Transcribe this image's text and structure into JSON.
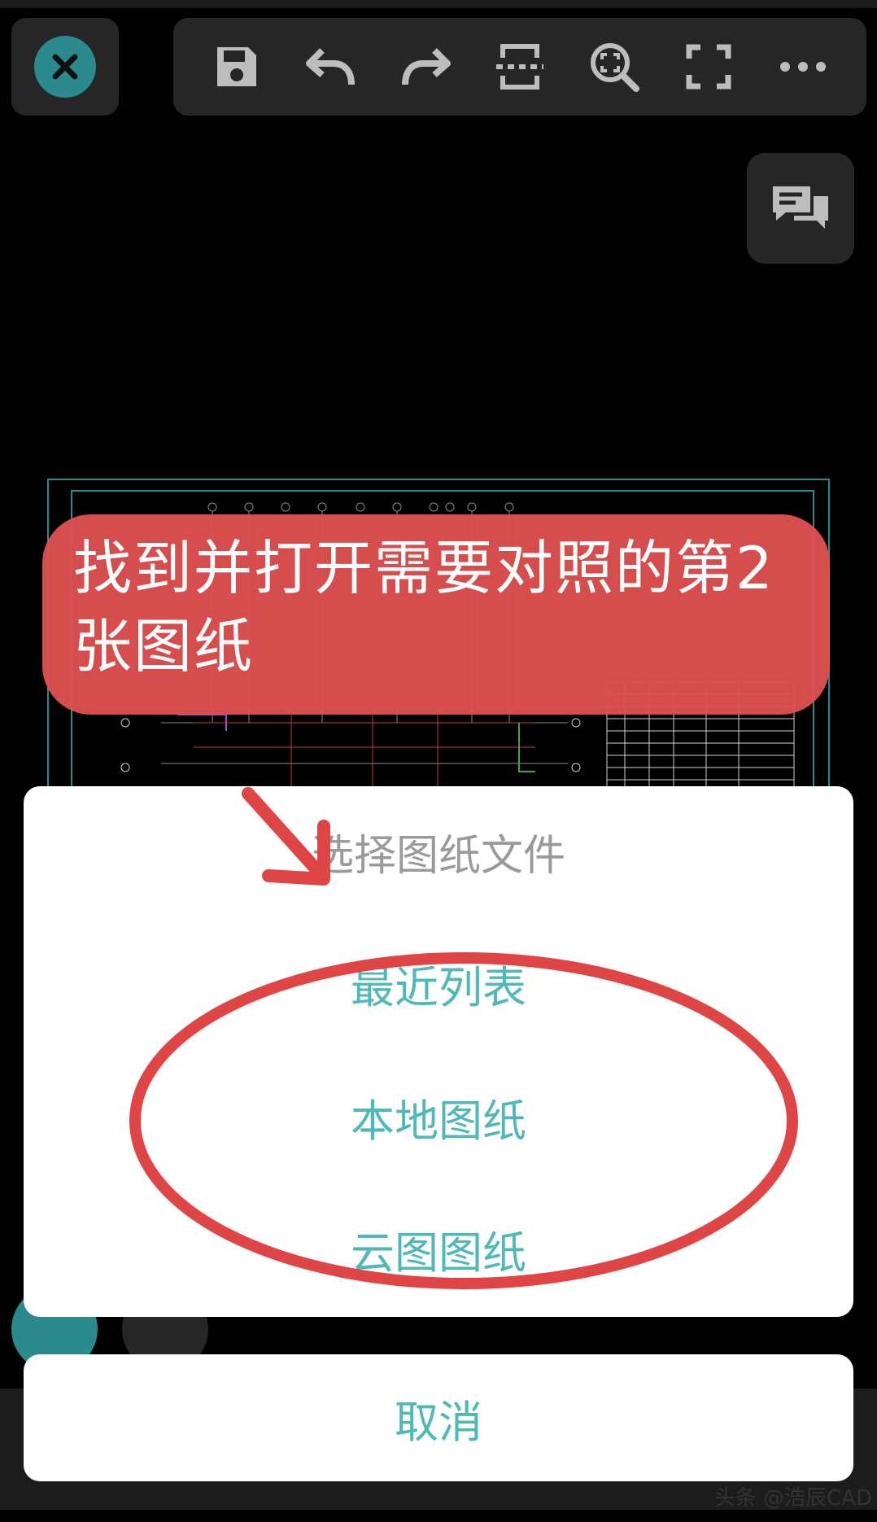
{
  "toolbar": {
    "close_icon": "close-icon",
    "buttons": [
      {
        "icon": "save-icon"
      },
      {
        "icon": "undo-icon"
      },
      {
        "icon": "redo-icon"
      },
      {
        "icon": "compare-icon"
      },
      {
        "icon": "zoom-extent-icon"
      },
      {
        "icon": "fullscreen-icon"
      },
      {
        "icon": "more-icon"
      }
    ]
  },
  "callout": {
    "text": "找到并打开需要对照的第2张图纸"
  },
  "sheet": {
    "title": "选择图纸文件",
    "options": [
      "最近列表",
      "本地图纸",
      "云图图纸"
    ],
    "cancel": "取消"
  },
  "watermark": "头条 @浩辰CAD",
  "colors": {
    "accent": "#4fb9b6",
    "callout": "#de5050",
    "close": "#2a8a8e",
    "toolbar": "#262626"
  }
}
